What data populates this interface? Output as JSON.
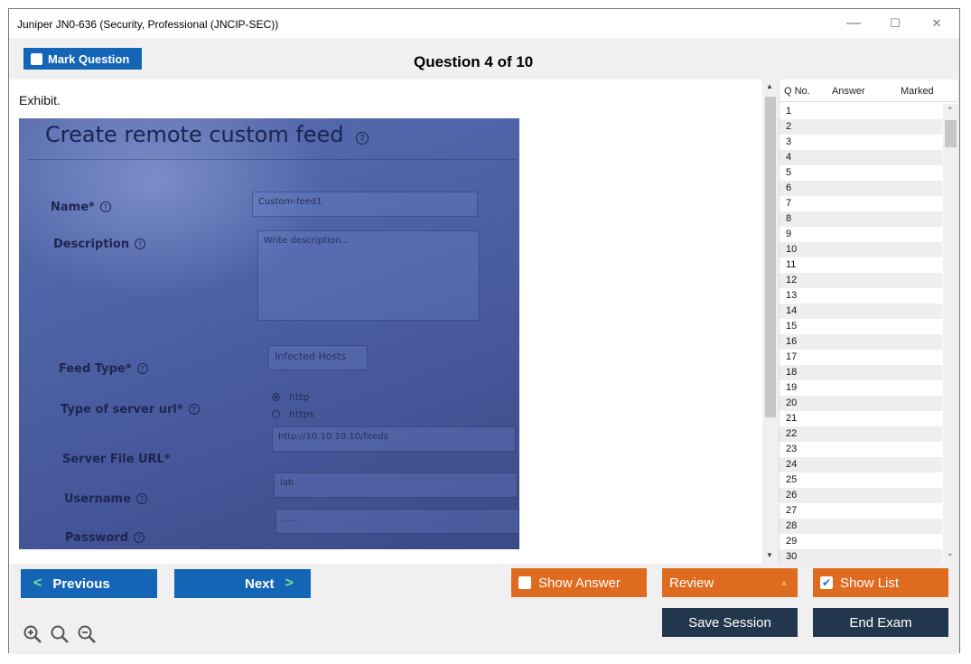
{
  "window": {
    "title": "Juniper JN0-636 (Security, Professional (JNCIP-SEC))",
    "controls": {
      "minimize": "—",
      "maximize": "☐",
      "close": "✕"
    }
  },
  "header": {
    "mark_question": "Mark Question",
    "question_counter": "Question 4 of 10"
  },
  "content": {
    "exhibit_label": "Exhibit.",
    "exhibit_image": {
      "heading": "Create remote custom feed",
      "fields": {
        "name_label": "Name*",
        "name_value": "Custom-feed1",
        "description_label": "Description",
        "description_placeholder": "Write description...",
        "feed_type_label": "Feed Type*",
        "feed_type_value": "Infected Hosts",
        "server_url_type_label": "Type of server url*",
        "server_url_options": [
          "http",
          "https"
        ],
        "server_url_selected": "http",
        "server_file_url_label": "Server File URL*",
        "server_file_url_value": "http://10.10.10.10/feeds",
        "username_label": "Username",
        "username_value": "lab",
        "password_label": "Password",
        "password_value": "......"
      }
    }
  },
  "question_list": {
    "columns": [
      "Q No.",
      "Answer",
      "Marked"
    ],
    "rows": [
      "1",
      "2",
      "3",
      "4",
      "5",
      "6",
      "7",
      "8",
      "9",
      "10",
      "11",
      "12",
      "13",
      "14",
      "15",
      "16",
      "17",
      "18",
      "19",
      "20",
      "21",
      "22",
      "23",
      "24",
      "25",
      "26",
      "27",
      "28",
      "29",
      "30"
    ]
  },
  "footer": {
    "previous": "Previous",
    "next": "Next",
    "show_answer": "Show Answer",
    "review": "Review",
    "show_list": "Show List",
    "save_session": "Save Session",
    "end_exam": "End Exam"
  },
  "colors": {
    "primary_blue": "#1565b7",
    "accent_orange": "#de6b1f",
    "navy": "#22374d",
    "arrow_green": "#7ee08a"
  }
}
